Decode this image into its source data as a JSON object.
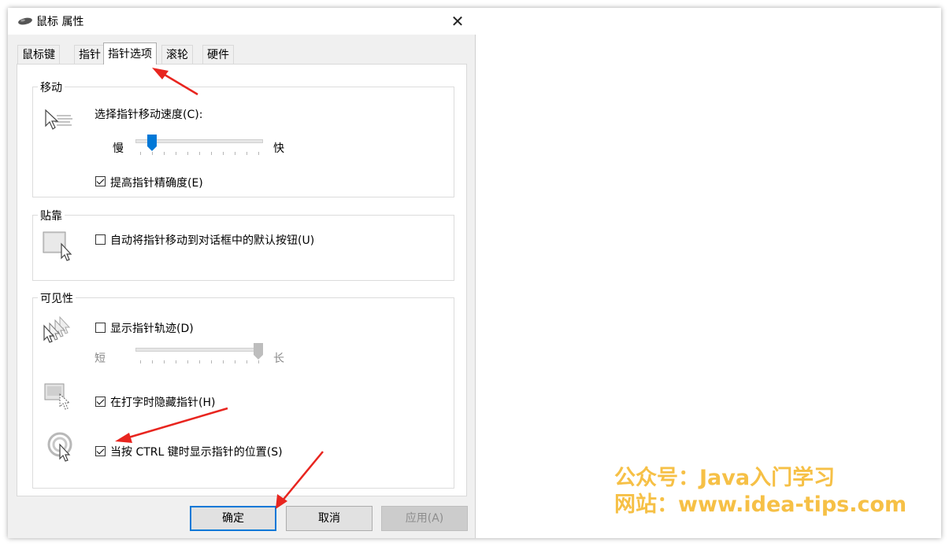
{
  "window": {
    "title": "鼠标 属性",
    "close_glyph": "✕"
  },
  "tabs": [
    {
      "label": "鼠标键",
      "active": false
    },
    {
      "label": "指针",
      "active": false
    },
    {
      "label": "指针选项",
      "active": true
    },
    {
      "label": "滚轮",
      "active": false
    },
    {
      "label": "硬件",
      "active": false
    }
  ],
  "motion": {
    "legend": "移动",
    "speed_label": "选择指针移动速度(C):",
    "slow_label": "慢",
    "fast_label": "快",
    "speed_level_fraction": 0.1,
    "precision_label": "提高指针精确度(E)",
    "precision_checked": true
  },
  "snap": {
    "legend": "贴靠",
    "snap_label": "自动将指针移动到对话框中的默认按钮(U)",
    "snap_checked": false
  },
  "visibility": {
    "legend": "可见性",
    "trails_label": "显示指针轨迹(D)",
    "trails_checked": false,
    "short_label": "短",
    "long_label": "长",
    "trail_level_fraction": 1.0,
    "hide_label": "在打字时隐藏指针(H)",
    "hide_checked": true,
    "ctrl_label": "当按 CTRL 键时显示指针的位置(S)",
    "ctrl_checked": true
  },
  "buttons": {
    "ok": "确定",
    "cancel": "取消",
    "apply": "应用(A)"
  },
  "watermark": {
    "line1": "公众号：Java入门学习",
    "line2": "网站：www.idea-tips.com"
  },
  "colors": {
    "accent": "#0078d7",
    "annotation_arrow": "#e8251f",
    "watermark": "#f6c046"
  },
  "icons": {
    "title": "mouse-icon",
    "speed": "pointer-speed-icon",
    "snap": "snap-to-icon",
    "trails": "pointer-trails-icon",
    "hide": "hide-pointer-icon",
    "ctrl": "ctrl-locate-icon"
  }
}
